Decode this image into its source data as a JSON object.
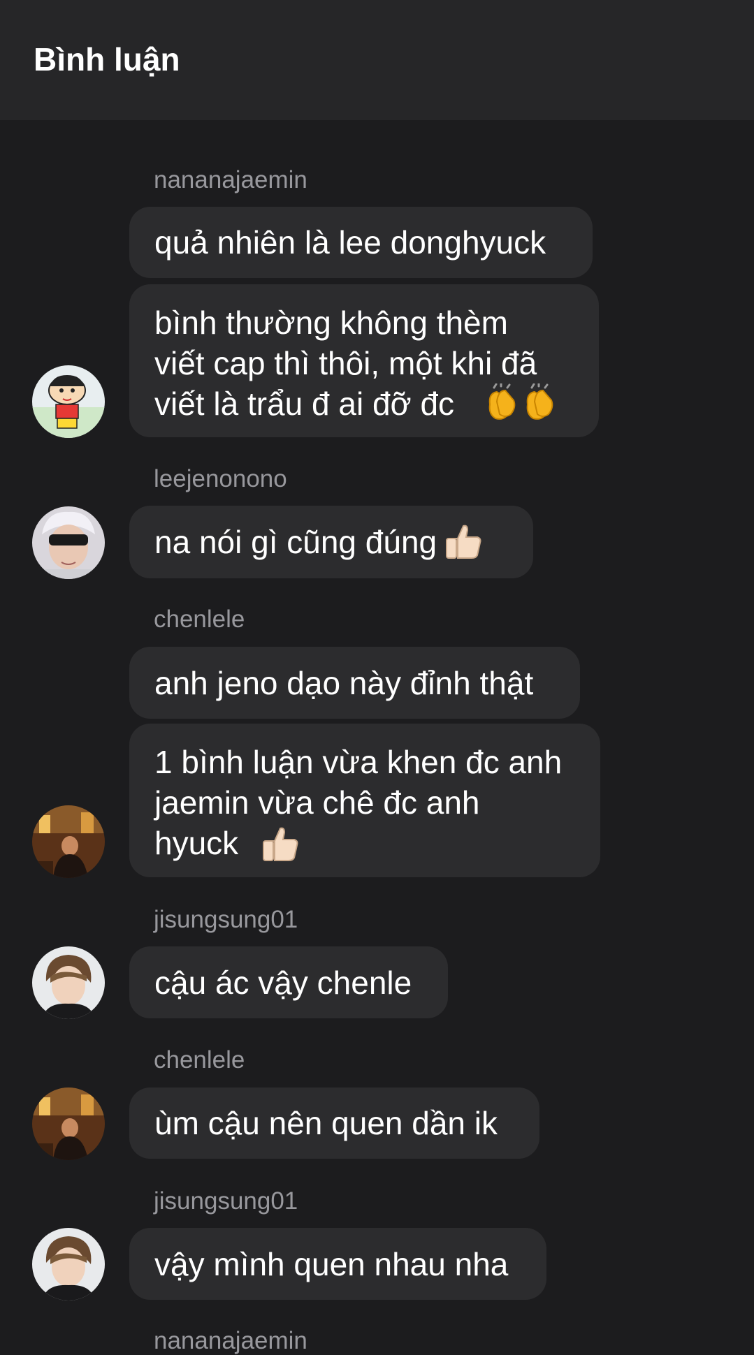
{
  "header": {
    "title": "Bình luận"
  },
  "comments": [
    {
      "username": "nananajaemin",
      "avatar": "cartoon-boy-avatar",
      "messages": [
        {
          "text": "quả nhiên là lee donghyuck",
          "emoji": ""
        },
        {
          "text": "bình thường không thèm\nviết cap thì thôi, một khi đã\nviết là trẩu đ ai đỡ đc",
          "emoji": "clapping-hands-icon"
        }
      ]
    },
    {
      "username": "leejenonono",
      "avatar": "masked-face-avatar",
      "messages": [
        {
          "text": "na nói gì cũng đúng",
          "emoji": "thumbs-up-icon"
        }
      ]
    },
    {
      "username": "chenlele",
      "avatar": "warm-room-photo-avatar",
      "messages": [
        {
          "text": "anh jeno dạo này đỉnh thật",
          "emoji": ""
        },
        {
          "text": "1 bình luận vừa khen đc anh\njaemin vừa chê đc anh\nhyuck",
          "emoji": "thumbs-up-icon"
        }
      ]
    },
    {
      "username": "jisungsung01",
      "avatar": "portrait-photo-avatar",
      "messages": [
        {
          "text": "cậu ác vậy chenle",
          "emoji": ""
        }
      ]
    },
    {
      "username": "chenlele",
      "avatar": "warm-room-photo-avatar",
      "messages": [
        {
          "text": "ùm cậu nên quen dần ik",
          "emoji": ""
        }
      ]
    },
    {
      "username": "jisungsung01",
      "avatar": "portrait-photo-avatar",
      "messages": [
        {
          "text": "vậy mình quen nhau nha",
          "emoji": ""
        }
      ]
    }
  ],
  "footer_partial_username": "nananajaemin"
}
